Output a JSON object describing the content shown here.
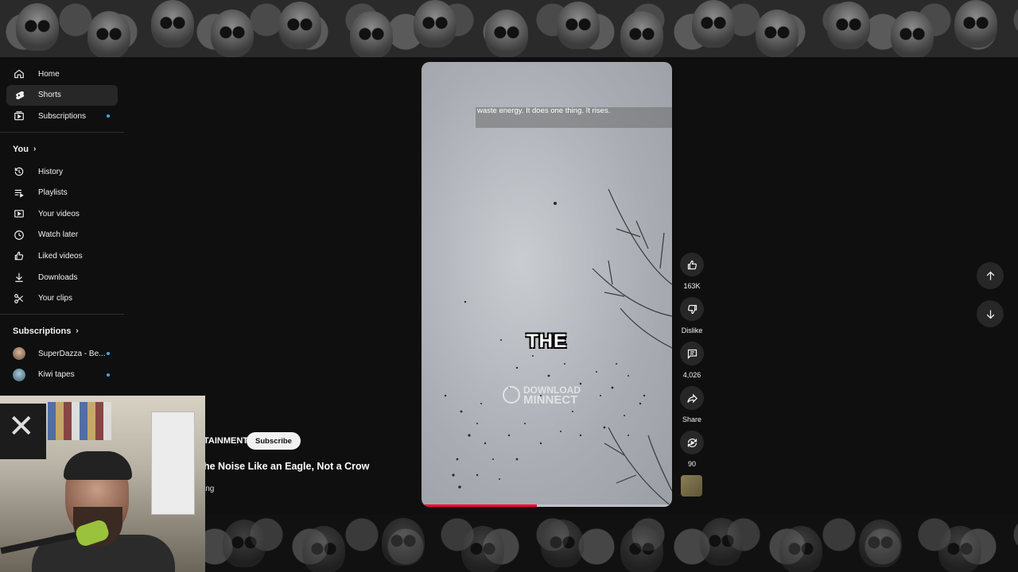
{
  "sidebar": {
    "main": [
      {
        "label": "Home",
        "icon": "home-icon"
      },
      {
        "label": "Shorts",
        "icon": "shorts-icon",
        "active": true
      },
      {
        "label": "Subscriptions",
        "icon": "subscriptions-icon",
        "new_dot": true
      }
    ],
    "you_heading": "You",
    "you": [
      {
        "label": "History",
        "icon": "history-icon"
      },
      {
        "label": "Playlists",
        "icon": "playlists-icon"
      },
      {
        "label": "Your videos",
        "icon": "your-videos-icon"
      },
      {
        "label": "Watch later",
        "icon": "watch-later-icon"
      },
      {
        "label": "Liked videos",
        "icon": "liked-videos-icon"
      },
      {
        "label": "Downloads",
        "icon": "downloads-icon"
      },
      {
        "label": "Your clips",
        "icon": "clips-icon"
      }
    ],
    "subscriptions_heading": "Subscriptions",
    "subscriptions": [
      {
        "label": "SuperDazza - Be...",
        "new_dot": true
      },
      {
        "label": "Kiwi tapes",
        "new_dot": true
      }
    ]
  },
  "player": {
    "caption": "waste energy. It does one thing. It rises.",
    "overlay_word": "THE",
    "watermark_line1": "DOWNLOAD",
    "watermark_line2": "MINNECT",
    "progress_fraction": 0.46
  },
  "actions": {
    "like_count": "163K",
    "dislike_label": "Dislike",
    "comment_count": "4,026",
    "share_label": "Share",
    "remix_count": "90"
  },
  "info": {
    "channel_fragment": "TAINMENT",
    "subscribe_label": "Subscribe",
    "title_fragment": "he Noise Like an Eagle, Not a Crow",
    "sound_fragment": "ing"
  },
  "colors": {
    "accent_red": "#ff0033",
    "new_dot": "#3ea6ff",
    "surface": "#0f0f0f",
    "chip": "#272727"
  }
}
